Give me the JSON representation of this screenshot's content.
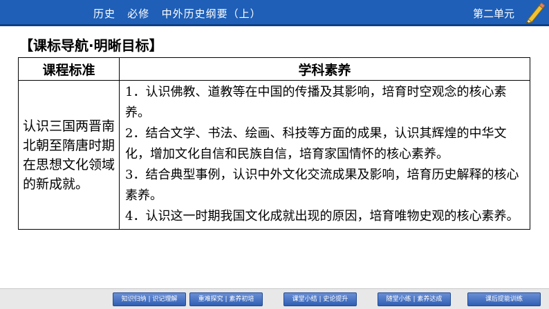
{
  "header": {
    "subject": "历史   必修   中外历史纲要（上）",
    "unit": "第二单元"
  },
  "section_title": "【课标导航·明晰目标】",
  "table": {
    "headers": [
      "课程标准",
      "学科素养"
    ],
    "standard": "认识三国两晋南北朝至隋唐时期在思想文化领域的新成就。",
    "literacy": [
      "1．认识佛教、道教等在中国的传播及其影响，培育时空观念的核心素养。",
      "2．结合文学、书法、绘画、科技等方面的成果，认识其辉煌的中华文化，增加文化自信和民族自信，培育家国情怀的核心素养。",
      "3．结合典型事例，认识中外文化交流成果及影响，培育历史解释的核心素养。",
      "4．认识这一时期我国文化成就出现的原因，培育唯物史观的核心素养。"
    ]
  },
  "footer_nav": [
    "知识归纳 | 识记理解",
    "重难探究 | 素养初培",
    "课堂小结 | 史论提升",
    "随堂小练 | 素养达成",
    "课后提能训练"
  ],
  "colors": {
    "header_bg": "#1f5fb7",
    "nav_btn": "#2f5fb3"
  },
  "icons": {
    "header_decoration": "pencil-icon"
  }
}
